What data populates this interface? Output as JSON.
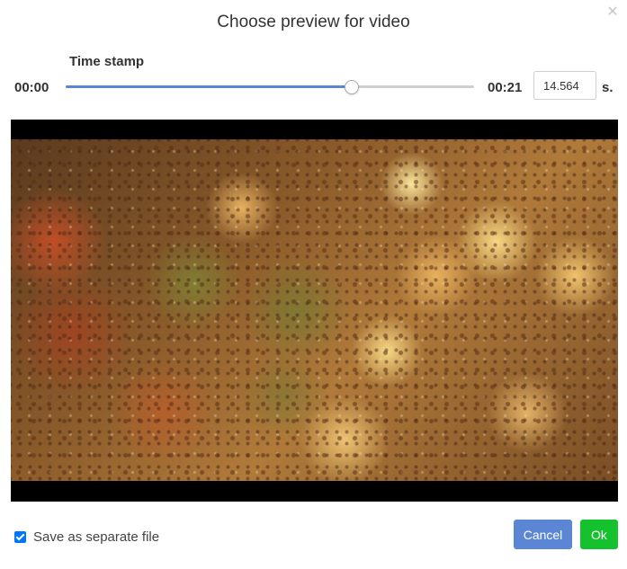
{
  "dialog": {
    "title": "Choose preview for video",
    "close_icon": "close-icon"
  },
  "timestamp": {
    "label": "Time stamp",
    "start_time": "00:00",
    "end_time": "00:21",
    "slider_position_percent": 70,
    "seconds_value": "14.564",
    "seconds_unit": "s."
  },
  "preview": {
    "image": "rainy-window-bokeh-frame"
  },
  "footer": {
    "checkbox_checked": true,
    "checkbox_label": "Save as separate file",
    "cancel_label": "Cancel",
    "ok_label": "Ok"
  },
  "colors": {
    "primary_button": "#5b86d6",
    "ok_button": "#16c12e",
    "slider_fill": "#5b86d6"
  }
}
